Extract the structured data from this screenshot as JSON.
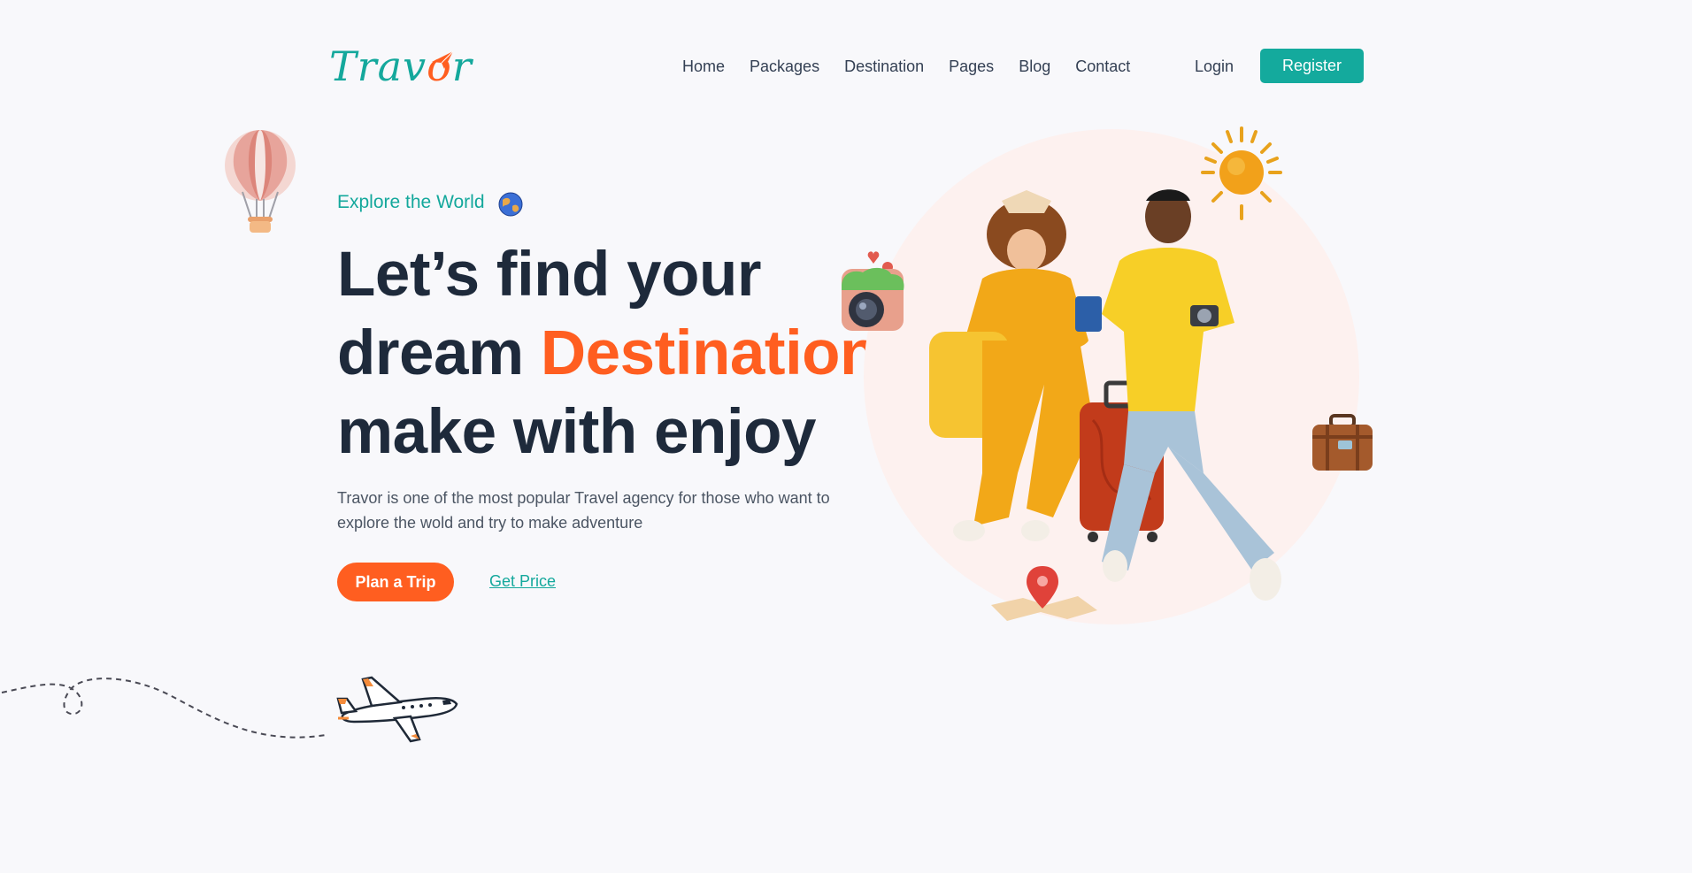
{
  "brand": {
    "logo_main": "Trav",
    "logo_accent": "o",
    "logo_end": "r",
    "accent_color": "#ff5e20",
    "primary_color": "#14aa9d"
  },
  "nav": {
    "items": [
      {
        "label": "Home"
      },
      {
        "label": "Packages"
      },
      {
        "label": "Destination"
      },
      {
        "label": "Pages"
      },
      {
        "label": "Blog"
      },
      {
        "label": "Contact"
      }
    ],
    "login": "Login",
    "register": "Register"
  },
  "hero": {
    "eyebrow": "Explore the World",
    "headline_line1": "Let’s find your",
    "headline_line2_pre": "dream ",
    "headline_line2_accent": "Destination",
    "headline_line3": "make with enjoy",
    "description": "Travor is one of the most popular Travel agency for those who want to explore the wold and try to make adventure",
    "primary_cta": "Plan a Trip",
    "secondary_cta": "Get Price"
  },
  "icons": {
    "balloon": "hot-air-balloon-icon",
    "globe": "globe-icon",
    "sun": "sun-icon",
    "camera": "camera-icon",
    "suitcase": "suitcase-icon",
    "map_pin": "map-pin-icon",
    "airplane": "airplane-icon"
  }
}
